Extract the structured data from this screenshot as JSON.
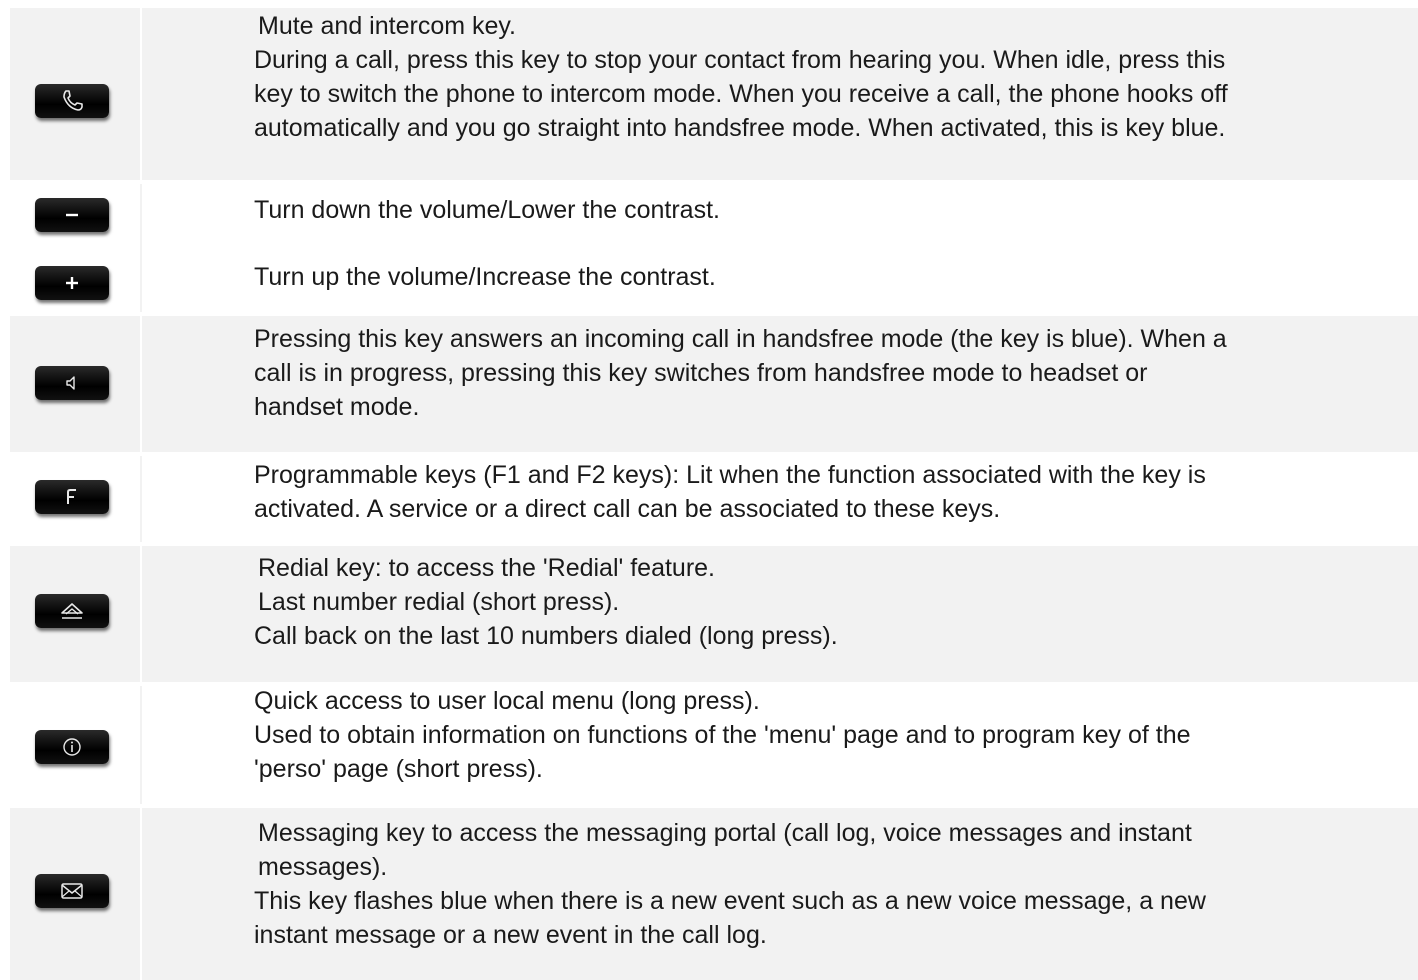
{
  "rows": [
    {
      "name": "mute-intercom",
      "lines": [
        "Mute and intercom key.",
        "During a call, press this key to stop your contact from hearing you. When idle, press this",
        "key to switch the phone to intercom mode. When you receive a call, the phone hooks off",
        "automatically and you go straight into handsfree mode. When activated, this is key blue."
      ]
    },
    {
      "name": "volume-down",
      "lines": [
        "Turn down the volume/Lower the contrast."
      ]
    },
    {
      "name": "volume-up",
      "lines": [
        "Turn up the volume/Increase the contrast."
      ]
    },
    {
      "name": "handsfree",
      "lines": [
        "Pressing this key answers an incoming call in handsfree mode (the key is blue). When a",
        "call is in progress, pressing this key switches from handsfree mode to headset or",
        "handset mode."
      ]
    },
    {
      "name": "programmable",
      "lines": [
        "Programmable keys (F1 and F2 keys): Lit when the function associated with the key is",
        "activated. A service or a direct call can be associated to these keys."
      ]
    },
    {
      "name": "redial",
      "lines": [
        "Redial key: to access the 'Redial' feature.",
        "Last number redial (short press).",
        "Call back on the last 10 numbers dialed (long press)."
      ]
    },
    {
      "name": "info",
      "lines": [
        "Quick access to user local menu (long press).",
        "Used to obtain information on functions of the 'menu' page and to program key of the",
        "'perso' page (short press)."
      ]
    },
    {
      "name": "messaging",
      "lines": [
        "Messaging key to access the messaging portal (call log, voice messages and instant",
        "messages).",
        "This key flashes blue when there is a new event such as a new voice message, a new",
        "instant message or a new event in the call log."
      ]
    }
  ],
  "icons": {
    "mute-intercom": "handset-icon",
    "volume-down": "minus-icon",
    "volume-up": "plus-icon",
    "handsfree": "speaker-icon",
    "programmable": "f-letter-icon",
    "redial": "redial-arrow-icon",
    "info": "info-icon",
    "messaging": "envelope-icon"
  },
  "colors": {
    "row_shade": "#f2f2f2",
    "key_body": "#000000",
    "text": "#1a1a1a"
  }
}
